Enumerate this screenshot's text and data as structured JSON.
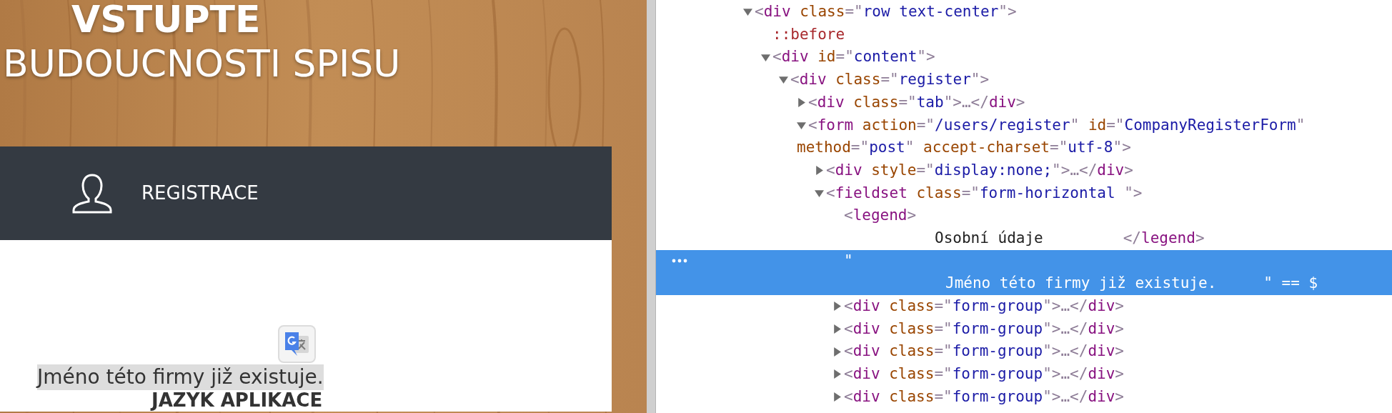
{
  "page": {
    "heading_lines": [
      {
        "text": "VSTUPTE",
        "bold": true
      },
      {
        "text": "BUDOUCNOSTI SPISU",
        "bold": false
      }
    ],
    "tab": {
      "label": "REGISTRACE"
    },
    "message": "Jméno této firmy již existuje.",
    "section_heading": "JAZYK APLIKACE"
  },
  "devtools": {
    "nodes": [
      {
        "expanded": true,
        "selected": false,
        "lines": [
          [
            {
              "kind": "punct",
              "text": "<"
            },
            {
              "kind": "tag",
              "text": "div"
            },
            {
              "kind": "attr",
              "text": "class"
            },
            {
              "kind": "punct",
              "text": "=\""
            },
            {
              "kind": "value",
              "text": "row text-center"
            },
            {
              "kind": "punct",
              "text": "\">"
            }
          ]
        ],
        "children": [
          {
            "selected": false,
            "lines": [
              [
                {
                  "kind": "pseudo",
                  "text": "::before"
                }
              ]
            ]
          },
          {
            "expanded": true,
            "selected": false,
            "lines": [
              [
                {
                  "kind": "punct",
                  "text": "<"
                },
                {
                  "kind": "tag",
                  "text": "div"
                },
                {
                  "kind": "attr",
                  "text": "id"
                },
                {
                  "kind": "punct",
                  "text": "=\""
                },
                {
                  "kind": "value",
                  "text": "content"
                },
                {
                  "kind": "punct",
                  "text": "\">"
                }
              ]
            ],
            "children": [
              {
                "expanded": true,
                "selected": false,
                "lines": [
                  [
                    {
                      "kind": "punct",
                      "text": "<"
                    },
                    {
                      "kind": "tag",
                      "text": "div"
                    },
                    {
                      "kind": "attr",
                      "text": "class"
                    },
                    {
                      "kind": "punct",
                      "text": "=\""
                    },
                    {
                      "kind": "value",
                      "text": "register"
                    },
                    {
                      "kind": "punct",
                      "text": "\">"
                    }
                  ]
                ],
                "children": [
                  {
                    "expanded": false,
                    "selected": false,
                    "lines": [
                      [
                        {
                          "kind": "punct",
                          "text": "<"
                        },
                        {
                          "kind": "tag",
                          "text": "div"
                        },
                        {
                          "kind": "attr",
                          "text": "class"
                        },
                        {
                          "kind": "punct",
                          "text": "=\""
                        },
                        {
                          "kind": "value",
                          "text": "tab"
                        },
                        {
                          "kind": "punct",
                          "text": "\">"
                        },
                        {
                          "kind": "punct",
                          "text": "…"
                        },
                        {
                          "kind": "punct",
                          "text": "</"
                        },
                        {
                          "kind": "tag",
                          "text": "div"
                        },
                        {
                          "kind": "punct",
                          "text": ">"
                        }
                      ]
                    ]
                  },
                  {
                    "expanded": true,
                    "selected": false,
                    "lines": [
                      [
                        {
                          "kind": "punct",
                          "text": "<"
                        },
                        {
                          "kind": "tag",
                          "text": "form"
                        },
                        {
                          "kind": "attr",
                          "text": "action"
                        },
                        {
                          "kind": "punct",
                          "text": "=\""
                        },
                        {
                          "kind": "value",
                          "text": "/users/register"
                        },
                        {
                          "kind": "punct",
                          "text": "\""
                        },
                        {
                          "kind": "attr",
                          "text": "id"
                        },
                        {
                          "kind": "punct",
                          "text": "=\""
                        },
                        {
                          "kind": "value",
                          "text": "CompanyRegisterForm"
                        },
                        {
                          "kind": "punct",
                          "text": "\""
                        }
                      ],
                      [
                        {
                          "kind": "attr",
                          "text": "method"
                        },
                        {
                          "kind": "punct",
                          "text": "=\""
                        },
                        {
                          "kind": "value",
                          "text": "post"
                        },
                        {
                          "kind": "punct",
                          "text": "\""
                        },
                        {
                          "kind": "attr",
                          "text": "accept-charset"
                        },
                        {
                          "kind": "punct",
                          "text": "=\""
                        },
                        {
                          "kind": "value",
                          "text": "utf-8"
                        },
                        {
                          "kind": "punct",
                          "text": "\">"
                        }
                      ]
                    ],
                    "children": [
                      {
                        "expanded": false,
                        "selected": false,
                        "lines": [
                          [
                            {
                              "kind": "punct",
                              "text": "<"
                            },
                            {
                              "kind": "tag",
                              "text": "div"
                            },
                            {
                              "kind": "attr",
                              "text": "style"
                            },
                            {
                              "kind": "punct",
                              "text": "=\""
                            },
                            {
                              "kind": "value",
                              "text": "display:none;"
                            },
                            {
                              "kind": "punct",
                              "text": "\">"
                            },
                            {
                              "kind": "punct",
                              "text": "…"
                            },
                            {
                              "kind": "punct",
                              "text": "</"
                            },
                            {
                              "kind": "tag",
                              "text": "div"
                            },
                            {
                              "kind": "punct",
                              "text": ">"
                            }
                          ]
                        ]
                      },
                      {
                        "expanded": true,
                        "selected": false,
                        "lines": [
                          [
                            {
                              "kind": "punct",
                              "text": "<"
                            },
                            {
                              "kind": "tag",
                              "text": "fieldset"
                            },
                            {
                              "kind": "attr",
                              "text": "class"
                            },
                            {
                              "kind": "punct",
                              "text": "=\""
                            },
                            {
                              "kind": "value",
                              "text": "form-horizontal "
                            },
                            {
                              "kind": "punct",
                              "text": "\">"
                            }
                          ]
                        ],
                        "children": [
                          {
                            "selected": false,
                            "lines": [
                              [
                                {
                                  "kind": "punct",
                                  "text": "<"
                                },
                                {
                                  "kind": "tag",
                                  "text": "legend"
                                },
                                {
                                  "kind": "punct",
                                  "text": ">"
                                }
                              ],
                              [
                                {
                                  "kind": "text",
                                  "text": "Osobní údaje"
                                },
                                {
                                  "kind": "punct",
                                  "text": "</"
                                },
                                {
                                  "kind": "tag",
                                  "text": "legend"
                                },
                                {
                                  "kind": "punct",
                                  "text": ">"
                                }
                              ]
                            ]
                          },
                          {
                            "selected": true,
                            "lines": [
                              [
                                {
                                  "kind": "punct",
                                  "text": "\""
                                }
                              ],
                              [
                                {
                                  "kind": "text",
                                  "text": "Jméno této firmy již existuje."
                                },
                                {
                                  "kind": "punct",
                                  "text": "\" == $"
                                }
                              ]
                            ]
                          },
                          {
                            "expanded": false,
                            "selected": false,
                            "lines": [
                              [
                                {
                                  "kind": "punct",
                                  "text": "<"
                                },
                                {
                                  "kind": "tag",
                                  "text": "div"
                                },
                                {
                                  "kind": "attr",
                                  "text": "class"
                                },
                                {
                                  "kind": "punct",
                                  "text": "=\""
                                },
                                {
                                  "kind": "value",
                                  "text": "form-group"
                                },
                                {
                                  "kind": "punct",
                                  "text": "\">"
                                },
                                {
                                  "kind": "punct",
                                  "text": "…"
                                },
                                {
                                  "kind": "punct",
                                  "text": "</"
                                },
                                {
                                  "kind": "tag",
                                  "text": "div"
                                },
                                {
                                  "kind": "punct",
                                  "text": ">"
                                }
                              ]
                            ]
                          },
                          {
                            "expanded": false,
                            "selected": false,
                            "lines": [
                              [
                                {
                                  "kind": "punct",
                                  "text": "<"
                                },
                                {
                                  "kind": "tag",
                                  "text": "div"
                                },
                                {
                                  "kind": "attr",
                                  "text": "class"
                                },
                                {
                                  "kind": "punct",
                                  "text": "=\""
                                },
                                {
                                  "kind": "value",
                                  "text": "form-group"
                                },
                                {
                                  "kind": "punct",
                                  "text": "\">"
                                },
                                {
                                  "kind": "punct",
                                  "text": "…"
                                },
                                {
                                  "kind": "punct",
                                  "text": "</"
                                },
                                {
                                  "kind": "tag",
                                  "text": "div"
                                },
                                {
                                  "kind": "punct",
                                  "text": ">"
                                }
                              ]
                            ]
                          },
                          {
                            "expanded": false,
                            "selected": false,
                            "lines": [
                              [
                                {
                                  "kind": "punct",
                                  "text": "<"
                                },
                                {
                                  "kind": "tag",
                                  "text": "div"
                                },
                                {
                                  "kind": "attr",
                                  "text": "class"
                                },
                                {
                                  "kind": "punct",
                                  "text": "=\""
                                },
                                {
                                  "kind": "value",
                                  "text": "form-group"
                                },
                                {
                                  "kind": "punct",
                                  "text": "\">"
                                },
                                {
                                  "kind": "punct",
                                  "text": "…"
                                },
                                {
                                  "kind": "punct",
                                  "text": "</"
                                },
                                {
                                  "kind": "tag",
                                  "text": "div"
                                },
                                {
                                  "kind": "punct",
                                  "text": ">"
                                }
                              ]
                            ]
                          },
                          {
                            "expanded": false,
                            "selected": false,
                            "lines": [
                              [
                                {
                                  "kind": "punct",
                                  "text": "<"
                                },
                                {
                                  "kind": "tag",
                                  "text": "div"
                                },
                                {
                                  "kind": "attr",
                                  "text": "class"
                                },
                                {
                                  "kind": "punct",
                                  "text": "=\""
                                },
                                {
                                  "kind": "value",
                                  "text": "form-group"
                                },
                                {
                                  "kind": "punct",
                                  "text": "\">"
                                },
                                {
                                  "kind": "punct",
                                  "text": "…"
                                },
                                {
                                  "kind": "punct",
                                  "text": "</"
                                },
                                {
                                  "kind": "tag",
                                  "text": "div"
                                },
                                {
                                  "kind": "punct",
                                  "text": ">"
                                }
                              ]
                            ]
                          },
                          {
                            "expanded": false,
                            "selected": false,
                            "lines": [
                              [
                                {
                                  "kind": "punct",
                                  "text": "<"
                                },
                                {
                                  "kind": "tag",
                                  "text": "div"
                                },
                                {
                                  "kind": "attr",
                                  "text": "class"
                                },
                                {
                                  "kind": "punct",
                                  "text": "=\""
                                },
                                {
                                  "kind": "value",
                                  "text": "form-group"
                                },
                                {
                                  "kind": "punct",
                                  "text": "\">"
                                },
                                {
                                  "kind": "punct",
                                  "text": "…"
                                },
                                {
                                  "kind": "punct",
                                  "text": "</"
                                },
                                {
                                  "kind": "tag",
                                  "text": "div"
                                },
                                {
                                  "kind": "punct",
                                  "text": ">"
                                }
                              ]
                            ]
                          }
                        ]
                      }
                    ]
                  }
                ]
              }
            ]
          }
        ]
      }
    ]
  }
}
